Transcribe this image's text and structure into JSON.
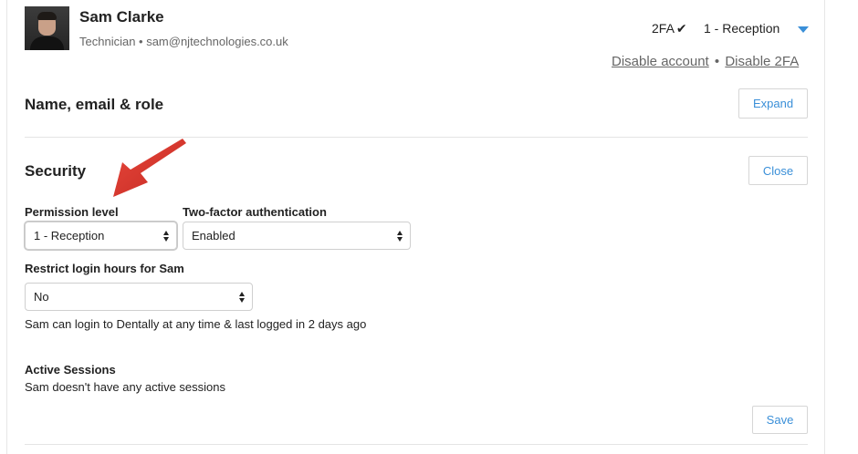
{
  "user": {
    "name": "Sam Clarke",
    "subtitle": "Technician • sam@njtechnologies.co.uk",
    "twofa_label": "2FA",
    "role": "1 - Reception"
  },
  "links": {
    "disable_account": "Disable account",
    "separator": "•",
    "disable_2fa": "Disable 2FA"
  },
  "sections": {
    "name_email_role": {
      "title": "Name, email & role",
      "button": "Expand"
    },
    "security": {
      "title": "Security",
      "button": "Close"
    }
  },
  "security": {
    "permission_label": "Permission level",
    "permission_value": "1 - Reception",
    "twofa_label": "Two-factor authentication",
    "twofa_value": "Enabled",
    "restrict_label": "Restrict login hours for Sam",
    "restrict_value": "No",
    "login_info": "Sam can login to Dentally at any time & last logged in 2 days ago",
    "sessions_label": "Active Sessions",
    "sessions_info": "Sam doesn't have any active sessions",
    "save_button": "Save"
  },
  "colors": {
    "accent": "#3a8fd8",
    "annotation_arrow": "#d9342b"
  },
  "icons": {
    "check": "check-icon",
    "caret": "caret-down-icon",
    "select_arrows": "updown-icon",
    "annotation": "annotation-arrow"
  }
}
